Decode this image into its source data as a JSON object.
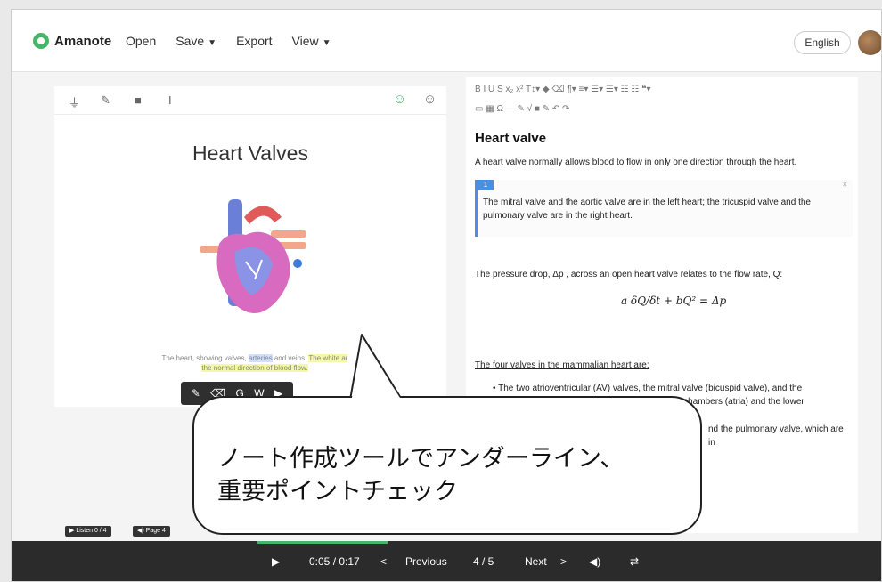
{
  "app": {
    "brand": "Amanote",
    "nav": [
      "Open",
      "Save",
      "Export",
      "View"
    ],
    "language": "English"
  },
  "pdf": {
    "title": "Heart Valves",
    "caption_pre": "The heart, showing valves, ",
    "caption_hl1": "arteries",
    "caption_mid": " and veins. ",
    "caption_hl2": "The white ar",
    "caption_line2_hl": "the normal direction of blood flow.",
    "popup_icons": [
      "pencil-icon",
      "eraser-icon",
      "google-icon",
      "wikipedia-icon",
      "youtube-icon"
    ],
    "popup_glyphs": [
      "✎",
      "⌫",
      "G",
      "W",
      "▶"
    ]
  },
  "editor": {
    "heading": "Heart valve",
    "intro": "A heart valve normally allows blood to flow in only one direction through the heart.",
    "note_number": "1",
    "note_close": "×",
    "note_text": "The mitral valve and the aortic valve are in the left heart; the tricuspid valve and the pulmonary valve are in the right heart.",
    "pressure_text": "The pressure drop, Δp , across an open heart valve relates to the flow rate, Q:",
    "formula": "a δQ/δt + bQ² = Δp",
    "section_title": "The four valves in the mammalian heart are:",
    "bullet1_line1": "• The two atrioventricular (AV) valves, the mitral valve (bicuspid valve), and the",
    "bullet1_line2": "tricuspid valve, which are between the upper chambers (atria) and the lower",
    "bullet2_tail": "nd the pulmonary valve, which are in",
    "toolbar_row1": "B   I   U   S   x₂   x²   T↕▾   ◆   ⌫   ¶▾   ≡▾   ☰▾   ☰▾   ☷   ☷   ❝▾",
    "toolbar_row2": "▭   ▦   Ω   —   ✎   √   ■   ✎   ↶   ↷"
  },
  "bubble": {
    "line1": "ノート作成ツールでアンダーライン、",
    "line2": "重要ポイントチェック"
  },
  "player": {
    "listen": "▶ Listen 0 / 4",
    "page": "◀) Page 4",
    "time": "0:05 / 0:17",
    "previous": "Previous",
    "page_counter": "4 / 5",
    "next": "Next",
    "progress_fraction": 0.29
  }
}
